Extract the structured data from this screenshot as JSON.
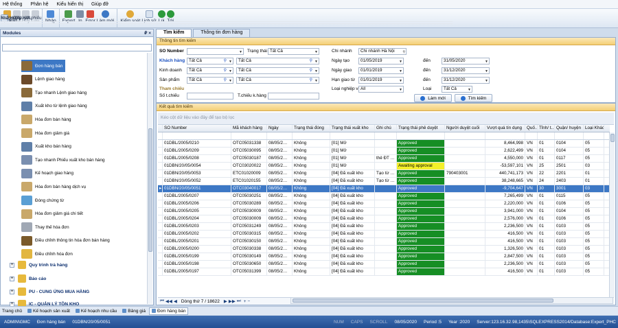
{
  "menu": [
    "Hệ thống",
    "Phân hệ",
    "Kiểu hiển thị",
    "Giúp đỡ"
  ],
  "toolbar": {
    "create_new": "Tạo mới",
    "edit": "Sửa",
    "delete": "Xóa",
    "cancel": "Hủy",
    "save": "Lưu",
    "cancel_approve": "Hủy duyệt phiếu",
    "import": "Nhập",
    "import_xml": "Nhập XML",
    "export": "Export",
    "print": "In",
    "error": "Error",
    "refresh": "Làm mới",
    "export_xml": "Xuất ra file XML",
    "inspect": "Kiểm soát",
    "history": "Lịch sử",
    "back": "Lùi",
    "forward": "Tới"
  },
  "left": {
    "title": "Modules",
    "pin": "₽",
    "close": "×",
    "items": [
      "Đơn hàng bán",
      "Lệnh giao hàng",
      "Tạo nhanh Lệnh giao hàng",
      "Xuất kho từ lệnh giao hàng",
      "Hóa đơn bán hàng",
      "Hóa đơn giảm giá",
      "Xuất kho bán hàng",
      "Tạo nhanh Phiếu xuất kho bán hàng",
      "Kế hoạch giao hàng",
      "Hóa đơn bán hàng dịch vụ",
      "Đóng chứng từ",
      "Hóa đơn giảm giá chi tiết",
      "Thay thế hóa đơn",
      "Điều chỉnh thông tin hóa đơn bán hàng",
      "Điều chỉnh hóa đơn"
    ],
    "groups": [
      "Quy trình trả hàng",
      "Báo cáo",
      "PU - CUNG ỨNG MUA HÀNG",
      "IC - QUẢN LÝ TỒN KHO"
    ]
  },
  "tabs": [
    "Tìm kiếm",
    "Thông tin đơn hàng"
  ],
  "search": {
    "header": "Thông tin tìm kiếm",
    "so_number_label": "SO Number",
    "status_label": "Trạng thái",
    "status_value": "Tất Cả",
    "customer_label": "Khách hàng",
    "customer_value1": "Tất Cả",
    "customer_value2": "Tất Cả",
    "business_label": "Kinh doanh",
    "business_value1": "Tất Cả",
    "business_value2": "Tất Cả",
    "product_label": "Sản phẩm",
    "product_value1": "Tất Cả",
    "product_value2": "Tất Cả",
    "ref_label": "Tham chiếu",
    "ref_no_label": "Số t.chiếu",
    "ref_customer_label": "T.chiếu k.hàng",
    "branch_label": "Chi nhánh",
    "branch_value": "Chi nhánh Hà Nội",
    "date_created_label": "Ngày tạo",
    "date_created_from": "01/05/2019",
    "date_created_to": "31/05/2020",
    "date_label": "Ngày giao",
    "date_from": "01/01/2019",
    "date_to": "31/12/2020",
    "due_label": "Hạn giao từ",
    "due_from": "01/01/2019",
    "due_to": "31/12/2020",
    "biz_type_label": "Loại nghiệp vụ",
    "biz_type_value": "All",
    "type_label": "Loại",
    "type_value": "Tất Cả",
    "to_label": "đến",
    "refresh_btn": "Làm mới",
    "search_btn": "Tìm kiếm"
  },
  "results": {
    "header": "Kết quả tìm kiếm",
    "group_hint": "Kéo cột dữ liệu vào đây để tạo bộ lọc",
    "columns": [
      "SO Number",
      "Mã khách hàng",
      "Ngày",
      "Trạng thái đóng",
      "Trạng thái xuất kho",
      "Ghi chú",
      "Trạng thái phê duyệt",
      "Người duyệt cuối",
      "Vượt quá tín dụng",
      "Quố…",
      "Tỉnh/ t…",
      "Quận/ huyện",
      "Loại Khách h…"
    ],
    "rows": [
      [
        "01DBL/2005/0210",
        "OTC05031338",
        "08/05/2…",
        "Không",
        "[01] Mở",
        "",
        "Approved",
        "",
        "8,464,998",
        "VN",
        "01",
        "0104",
        "05"
      ],
      [
        "01DBL/2005/0209",
        "OTC05030095",
        "08/05/2…",
        "Không",
        "[01] Mở",
        "",
        "Approved",
        "",
        "2,622,499",
        "VN",
        "01",
        "0104",
        "05"
      ],
      [
        "01DBL/2005/0208",
        "OTC05030187",
        "08/05/2…",
        "Không",
        "[01] Mở",
        "thẻ ĐT …",
        "Approved",
        "",
        "4,550,000",
        "VN",
        "01",
        "0117",
        "05"
      ],
      [
        "01DBN/20/05/0054",
        "OTC03020022",
        "08/05/2…",
        "Không",
        "[01] Mở",
        "",
        "Awaiting approval",
        "",
        "-53,597,101",
        "VN",
        "25",
        "2501",
        "03"
      ],
      [
        "01DBN/20/05/0053",
        "ETC01020009",
        "08/05/2…",
        "Không",
        "[04] Đã xuất kho",
        "Tạo từ …",
        "Approved",
        "790403001",
        "440,741,173",
        "VN",
        "22",
        "2201",
        "01"
      ],
      [
        "01DBN/20/05/0052",
        "ETC01020155",
        "08/05/2…",
        "Không",
        "[04] Đã xuất kho",
        "Tạo từ …",
        "Approved",
        "",
        "38,248,665",
        "VN",
        "24",
        "2403",
        "01"
      ],
      [
        "01DBN/20/05/0051",
        "OTC03040017",
        "08/05/2…",
        "Không",
        "[04] Đã xuất kho",
        "",
        "Approved",
        "",
        "-9,704,647",
        "VN",
        "30",
        "3001",
        "03"
      ],
      [
        "01DBL/2005/0207",
        "OTC05030251",
        "08/05/2…",
        "Không",
        "[04] Đã xuất kho",
        "",
        "Approved",
        "",
        "7,265,499",
        "VN",
        "01",
        "0115",
        "05"
      ],
      [
        "01DBL/2005/0206",
        "OTC05030289",
        "08/05/2…",
        "Không",
        "[04] Đã xuất kho",
        "",
        "Approved",
        "",
        "2,220,000",
        "VN",
        "01",
        "0106",
        "05"
      ],
      [
        "01DBL/2005/0205",
        "OTC05030009",
        "08/05/2…",
        "Không",
        "[04] Đã xuất kho",
        "",
        "Approved",
        "",
        "3,941,000",
        "VN",
        "01",
        "0104",
        "05"
      ],
      [
        "01DBL/2005/0204",
        "OTC05030009",
        "08/05/2…",
        "Không",
        "[04] Đã xuất kho",
        "",
        "Approved",
        "",
        "2,576,000",
        "VN",
        "01",
        "0106",
        "05"
      ],
      [
        "01DBL/2005/0203",
        "OTC05031249",
        "08/05/2…",
        "Không",
        "[04] Đã xuất kho",
        "",
        "Approved",
        "",
        "2,236,500",
        "VN",
        "01",
        "0103",
        "05"
      ],
      [
        "01DBL/2005/0202",
        "OTC05030315",
        "08/05/2…",
        "Không",
        "[04] Đã xuất kho",
        "",
        "Approved",
        "",
        "416,500",
        "VN",
        "01",
        "0103",
        "05"
      ],
      [
        "01DBL/2005/0201",
        "OTC05030150",
        "08/05/2…",
        "Không",
        "[04] Đã xuất kho",
        "",
        "Approved",
        "",
        "416,500",
        "VN",
        "01",
        "0103",
        "05"
      ],
      [
        "01DBL/2005/0200",
        "OTC05030338",
        "08/05/2…",
        "Không",
        "[04] Đã xuất kho",
        "",
        "Approved",
        "",
        "1,326,500",
        "VN",
        "01",
        "0103",
        "05"
      ],
      [
        "01DBL/2005/0199",
        "OTC05030149",
        "08/05/2…",
        "Không",
        "[04] Đã xuất kho",
        "",
        "Approved",
        "",
        "2,847,500",
        "VN",
        "01",
        "0103",
        "05"
      ],
      [
        "01DBL/2005/0198",
        "OTC05030650",
        "08/05/2…",
        "Không",
        "[04] Đã xuất kho",
        "",
        "Approved",
        "",
        "2,236,500",
        "VN",
        "01",
        "0103",
        "05"
      ],
      [
        "01DBL/2005/0197",
        "OTC05031399",
        "08/05/2…",
        "Không",
        "[04] Đã xuất kho",
        "",
        "Approved",
        "",
        "416,500",
        "VN",
        "01",
        "0103",
        "05"
      ]
    ],
    "nav_text": "Dòng thứ 7 / 18622",
    "selected_row": 6
  },
  "windows": [
    "Trang chủ",
    "Kế hoạch sản xuất",
    "Kế hoạch nhu cầu",
    "Bảng giá",
    "Đơn hàng bán"
  ],
  "status": {
    "user": "ADMIN\\GMC",
    "module": "Đơn hàng bán",
    "doc": "01DBN/20/05/0051",
    "num": "NUM",
    "caps": "CAPS",
    "scroll": "SCROLL",
    "date": "08/05/2020",
    "period": "Period :5",
    "year": "Year :2020",
    "server": "Server:123.16.32.98,1435\\SQLEXPRESS2014/Database:Expert_PHC"
  },
  "colors": {
    "approved": "#168e24",
    "awaiting": "#f4f02a",
    "selection": "#3d78c5"
  }
}
